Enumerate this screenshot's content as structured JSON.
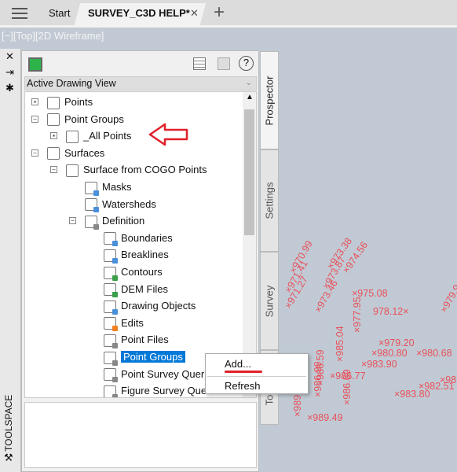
{
  "tabs": {
    "start": "Start",
    "active": "SURVEY_C3D HELP*",
    "close": "✕",
    "add": "+"
  },
  "viewport": {
    "label": "[−][Top][2D Wireframe]",
    "points": [
      "×970.99",
      "×971.41",
      "×971.27",
      "×973.38",
      "×973.87",
      "×973.46",
      "×974.56",
      "×975.08",
      "978.12×",
      "×977.95",
      "×979.20",
      "×980.80",
      "×980.68",
      "×985.04",
      "×983.90",
      "×986.77",
      "×986.69",
      "×986.99",
      "×986.59",
      "×982.51",
      "×983.80",
      "×989.49",
      "×989.4",
      "×981.",
      "×979.9"
    ]
  },
  "toolspace": {
    "label": "TOOLSPACE",
    "close": "✕",
    "accent": "#2db34a"
  },
  "panel": {
    "dropdown": "Active Drawing View",
    "help": "?",
    "tree": [
      {
        "label": "Points",
        "level": 1
      },
      {
        "label": "Point Groups",
        "level": 1
      },
      {
        "label": "_All Points",
        "level": 2
      },
      {
        "label": "Surfaces",
        "level": 1
      },
      {
        "label": "Surface from COGO Points",
        "level": 2
      },
      {
        "label": "Masks",
        "level": 3
      },
      {
        "label": "Watersheds",
        "level": 3
      },
      {
        "label": "Definition",
        "level": 3
      },
      {
        "label": "Boundaries",
        "level": 4
      },
      {
        "label": "Breaklines",
        "level": 4
      },
      {
        "label": "Contours",
        "level": 4
      },
      {
        "label": "DEM Files",
        "level": 4
      },
      {
        "label": "Drawing Objects",
        "level": 4
      },
      {
        "label": "Edits",
        "level": 4
      },
      {
        "label": "Point Files",
        "level": 4
      },
      {
        "label": "Point Groups",
        "level": 4,
        "selected": true
      },
      {
        "label": "Point Survey Queries",
        "level": 4
      },
      {
        "label": "Figure Survey Queries",
        "level": 4
      }
    ]
  },
  "side_tabs": [
    "Prospector",
    "Settings",
    "Survey",
    "Toolbox"
  ],
  "context_menu": {
    "items": [
      "Add...",
      "Refresh"
    ]
  },
  "annotation_color": "#e0202a"
}
